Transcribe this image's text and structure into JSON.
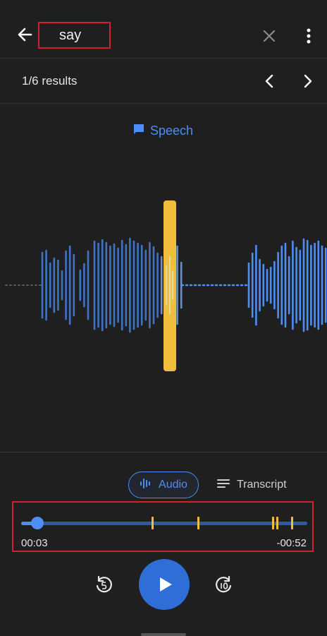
{
  "search": {
    "query": "say"
  },
  "results": {
    "label": "1/6 results"
  },
  "category": {
    "label": "Speech"
  },
  "tabs": [
    {
      "label": "Audio",
      "selected": true
    },
    {
      "label": "Transcript",
      "selected": false
    }
  ],
  "playback": {
    "elapsed": "00:03",
    "remaining": "-00:52",
    "progress": 0.05
  },
  "icons": {
    "back": "arrow-back-icon",
    "clear": "close-icon",
    "more": "more-vert-icon",
    "prev": "chevron-left-icon",
    "next": "chevron-right-icon",
    "speech": "chat-bubble-icon",
    "audio": "waveform-icon",
    "transcript": "notes-icon",
    "rewind": "replay-5-icon",
    "play": "play-icon",
    "forward": "forward-10-icon"
  },
  "colors": {
    "background": "#1f1f1f",
    "accent": "#4c8df6",
    "highlight": "#f0bd3c",
    "annotation": "#d4202a"
  }
}
